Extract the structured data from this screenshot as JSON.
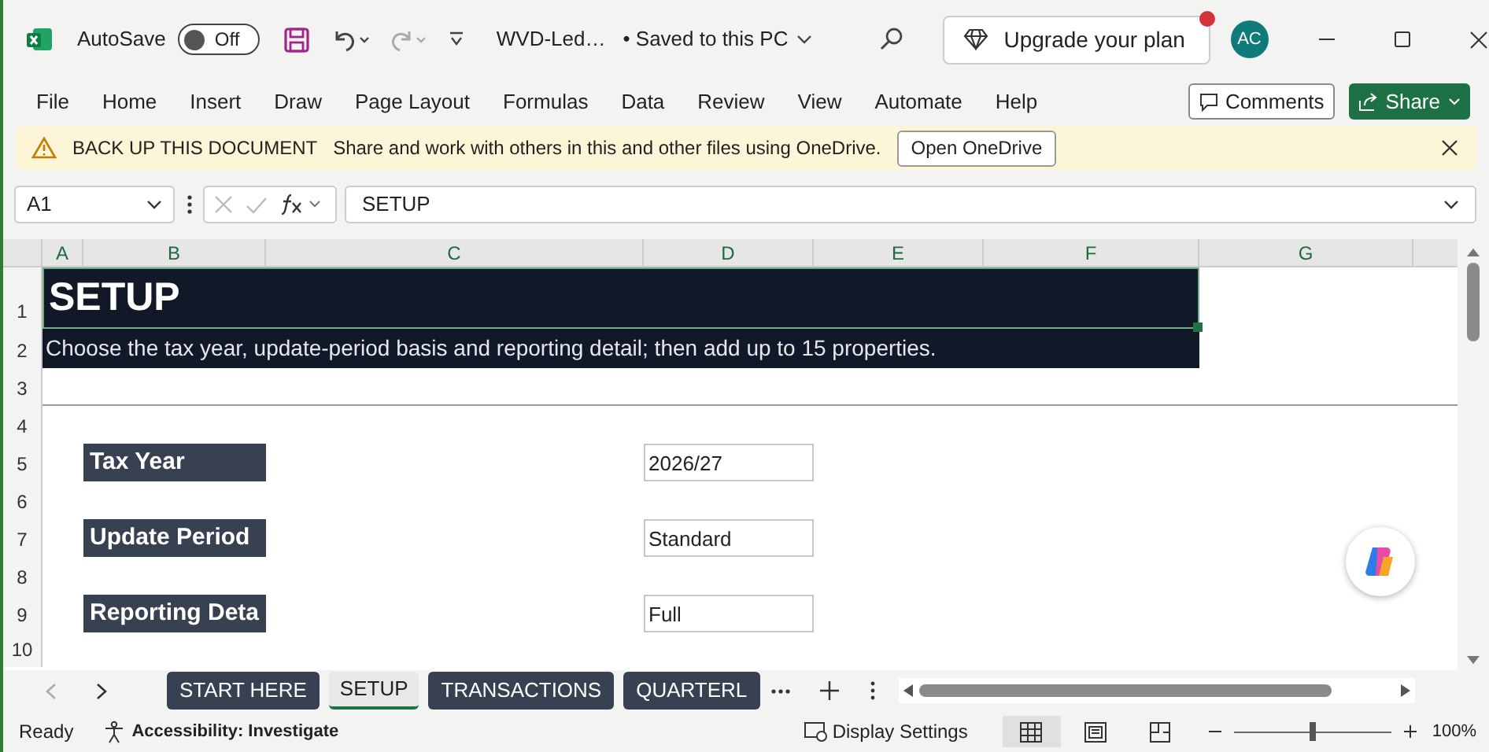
{
  "title_bar": {
    "autosave_label": "AutoSave",
    "autosave_state": "Off",
    "autosave_on": false,
    "file_name": "WVD-Led…",
    "save_status": "• Saved to this PC",
    "upgrade_button": "Upgrade your plan",
    "avatar": "AC"
  },
  "ribbon_tabs": [
    "File",
    "Home",
    "Insert",
    "Draw",
    "Page Layout",
    "Formulas",
    "Data",
    "Review",
    "View",
    "Automate",
    "Help"
  ],
  "comments_button": "Comments",
  "share_button": "Share",
  "message_bar": {
    "title": "BACK UP THIS DOCUMENT",
    "text": "Share and work with others in this and other files using OneDrive.",
    "button": "Open OneDrive"
  },
  "formula_bar": {
    "name_box": "A1",
    "formula": "SETUP"
  },
  "columns": [
    "A",
    "B",
    "C",
    "D",
    "E",
    "F",
    "G"
  ],
  "rows": [
    "1",
    "2",
    "3",
    "4",
    "5",
    "6",
    "7",
    "8",
    "9",
    "10"
  ],
  "sheet": {
    "title": "SETUP",
    "subtitle": "Choose the tax year, update-period basis and reporting detail; then add up to 15 properties.",
    "fields": [
      {
        "label": "Tax Year",
        "value": "2026/27"
      },
      {
        "label": "Update Period",
        "value": "Standard"
      },
      {
        "label": "Reporting Deta",
        "value": "Full"
      }
    ]
  },
  "sheet_tabs": [
    {
      "label": "START HERE",
      "selected": false
    },
    {
      "label": "SETUP",
      "selected": true
    },
    {
      "label": "TRANSACTIONS",
      "selected": false
    },
    {
      "label": "QUARTERL",
      "selected": false
    }
  ],
  "status_bar": {
    "status": "Ready",
    "accessibility": "Accessibility: Investigate",
    "display_settings": "Display Settings",
    "views": [
      {
        "kind": "normal",
        "selected": true
      },
      {
        "kind": "page_layout",
        "selected": false
      },
      {
        "kind": "page_break",
        "selected": false
      }
    ],
    "zoom_slider": {
      "level": 0.5
    },
    "zoom": "100%"
  }
}
